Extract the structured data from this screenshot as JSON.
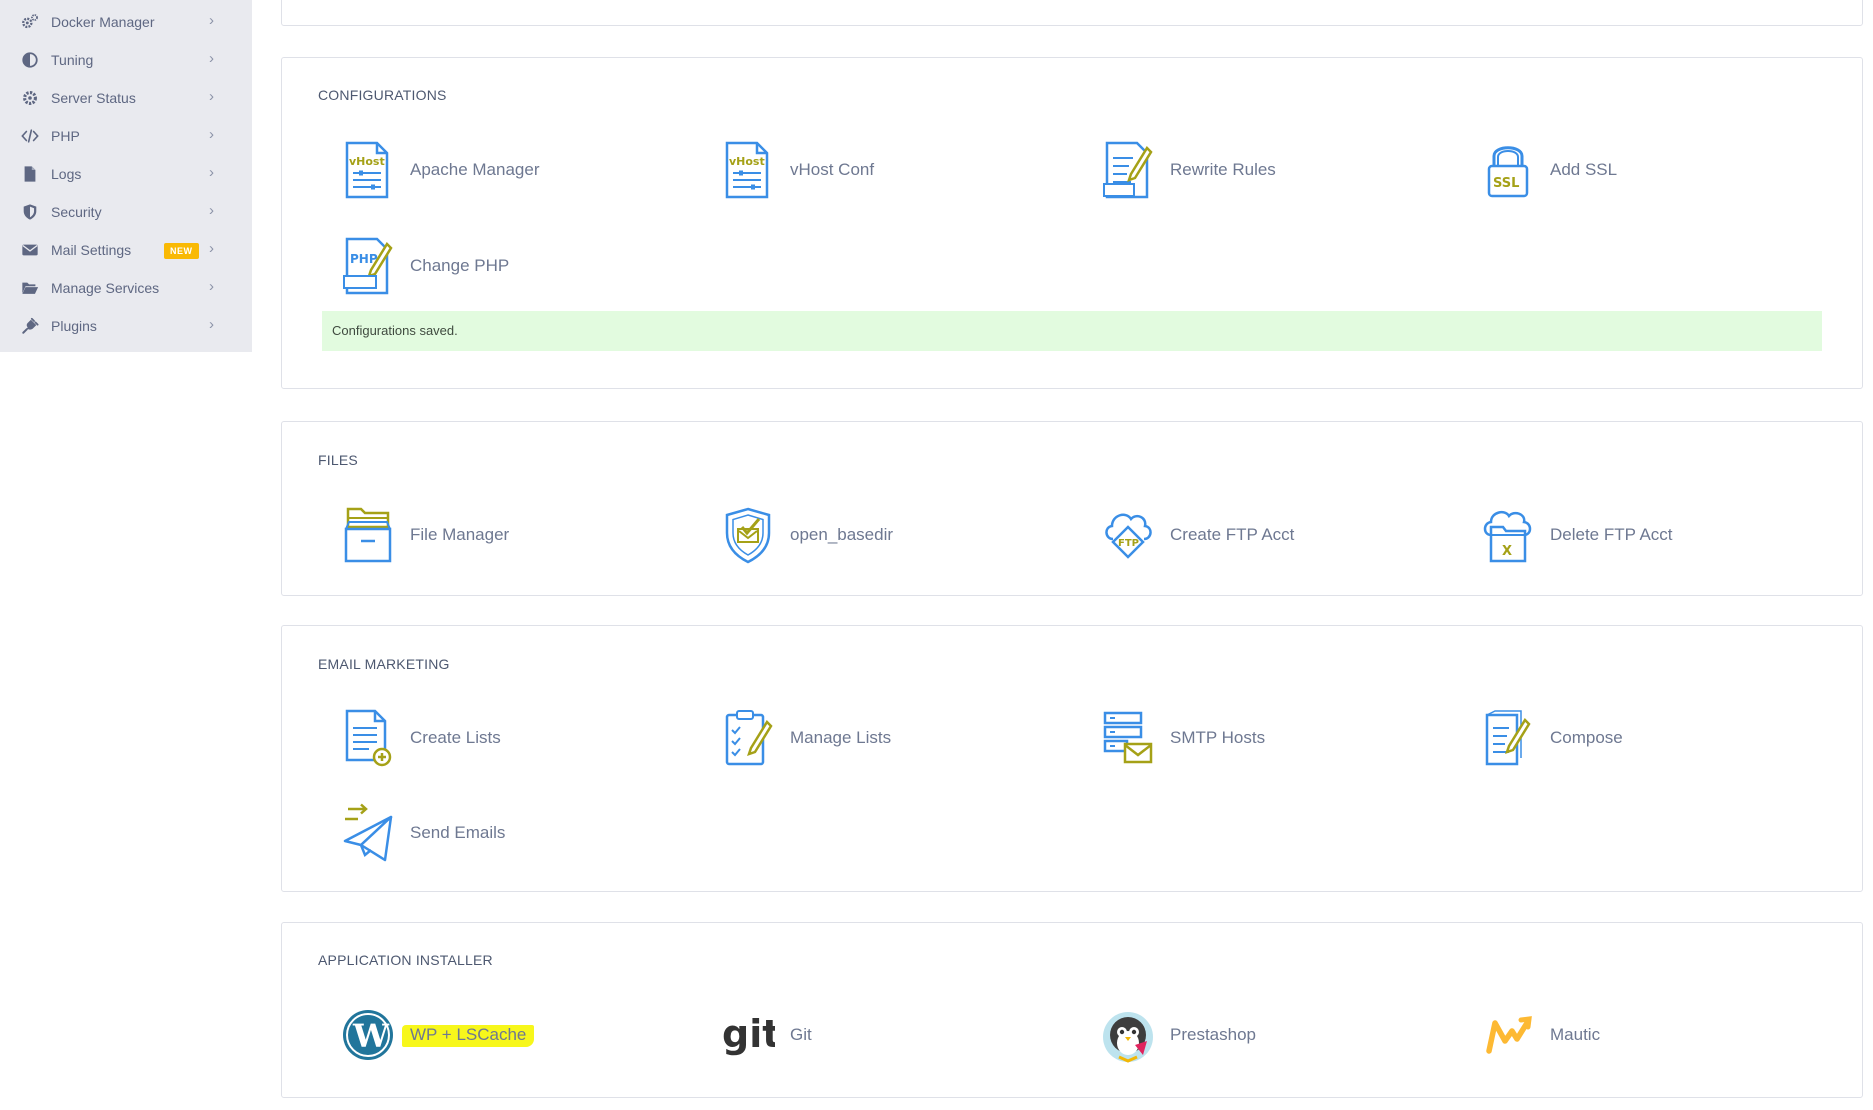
{
  "sidebar": {
    "items": [
      {
        "label": "Docker Manager",
        "icon": "gears-icon"
      },
      {
        "label": "Tuning",
        "icon": "contrast-icon"
      },
      {
        "label": "Server Status",
        "icon": "gear-icon"
      },
      {
        "label": "PHP",
        "icon": "code-icon"
      },
      {
        "label": "Logs",
        "icon": "file-icon"
      },
      {
        "label": "Security",
        "icon": "shield-icon"
      },
      {
        "label": "Mail Settings",
        "icon": "envelope-icon",
        "badge": "NEW"
      },
      {
        "label": "Manage Services",
        "icon": "folder-open-icon"
      },
      {
        "label": "Plugins",
        "icon": "plug-icon"
      }
    ]
  },
  "sections": {
    "configurations": {
      "title": "CONFIGURATIONS",
      "tiles": [
        {
          "label": "Apache Manager",
          "icon": "vhost-document-icon"
        },
        {
          "label": "vHost Conf",
          "icon": "vhost-document-icon"
        },
        {
          "label": "Rewrite Rules",
          "icon": "edit-document-icon"
        },
        {
          "label": "Add SSL",
          "icon": "ssl-lock-icon"
        },
        {
          "label": "Change PHP",
          "icon": "php-document-icon"
        }
      ],
      "alert": "Configurations saved."
    },
    "files": {
      "title": "FILES",
      "tiles": [
        {
          "label": "File Manager",
          "icon": "file-cabinet-icon"
        },
        {
          "label": "open_basedir",
          "icon": "shield-check-icon"
        },
        {
          "label": "Create FTP Acct",
          "icon": "ftp-cloud-icon"
        },
        {
          "label": "Delete FTP Acct",
          "icon": "cloud-folder-delete-icon"
        }
      ]
    },
    "email_marketing": {
      "title": "EMAIL MARKETING",
      "tiles": [
        {
          "label": "Create Lists",
          "icon": "document-add-icon"
        },
        {
          "label": "Manage Lists",
          "icon": "checklist-icon"
        },
        {
          "label": "SMTP Hosts",
          "icon": "server-mail-icon"
        },
        {
          "label": "Compose",
          "icon": "compose-icon"
        },
        {
          "label": "Send Emails",
          "icon": "paper-plane-icon"
        }
      ]
    },
    "application_installer": {
      "title": "APPLICATION INSTALLER",
      "tiles": [
        {
          "label": "WP + LSCache",
          "icon": "wordpress-icon",
          "highlighted": true
        },
        {
          "label": "Git",
          "icon": "git-logo-icon",
          "logo_text": "git"
        },
        {
          "label": "Prestashop",
          "icon": "prestashop-icon"
        },
        {
          "label": "Mautic",
          "icon": "mautic-icon"
        }
      ]
    }
  },
  "colors": {
    "sidebar_bg": "#e9eaef",
    "icon_blue": "#3a8ee6",
    "icon_olive": "#a5a117",
    "badge": "#f9b904",
    "alert_bg": "#e2fbdf",
    "highlight": "#f7f71b"
  }
}
